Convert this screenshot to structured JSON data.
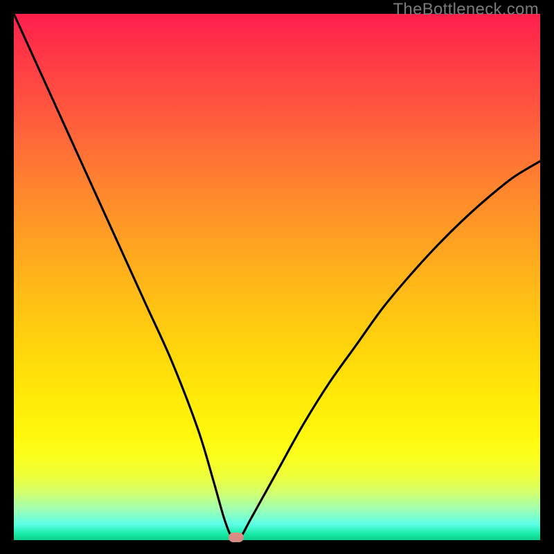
{
  "watermark": "TheBottleneck.com",
  "chart_data": {
    "type": "line",
    "title": "",
    "xlabel": "",
    "ylabel": "",
    "xlim": [
      0,
      100
    ],
    "ylim": [
      0,
      100
    ],
    "series": [
      {
        "name": "bottleneck-curve",
        "x": [
          0,
          5,
          10,
          15,
          20,
          25,
          30,
          35,
          38,
          40,
          41.5,
          43,
          45,
          50,
          55,
          60,
          65,
          70,
          75,
          80,
          85,
          90,
          95,
          100
        ],
        "y": [
          100,
          89,
          78,
          67,
          56,
          45,
          34,
          21,
          11,
          4,
          0.5,
          0.5,
          4,
          13,
          22,
          30,
          37,
          44,
          50,
          55.5,
          60.5,
          65,
          69,
          72
        ]
      }
    ],
    "marker": {
      "x": 42.3,
      "y": 0.5
    },
    "background_gradient": {
      "top": "#ff1f4c",
      "mid": "#ffd60b",
      "bottom": "#0fce8d"
    }
  }
}
